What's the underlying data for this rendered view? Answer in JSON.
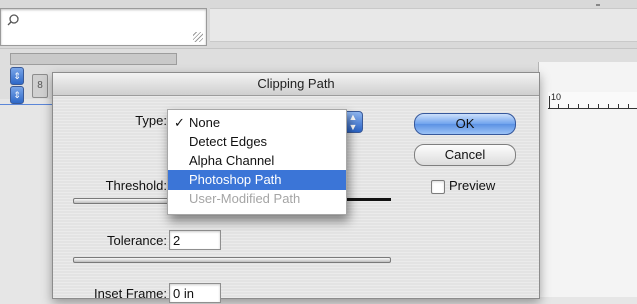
{
  "dialog": {
    "title": "Clipping Path",
    "type_label": "Type:",
    "threshold_label": "Threshold:",
    "tolerance_label": "Tolerance:",
    "tolerance_value": "2",
    "inset_label": "Inset Frame:",
    "inset_value": "0 in",
    "ok_label": "OK",
    "cancel_label": "Cancel",
    "preview_label": "Preview",
    "preview_checked": false
  },
  "type_menu": {
    "items": [
      {
        "label": "None",
        "checked": true,
        "state": "normal"
      },
      {
        "label": "Detect Edges",
        "checked": false,
        "state": "normal"
      },
      {
        "label": "Alpha Channel",
        "checked": false,
        "state": "normal"
      },
      {
        "label": "Photoshop Path",
        "checked": false,
        "state": "highlighted"
      },
      {
        "label": "User-Modified Path",
        "checked": false,
        "state": "disabled"
      }
    ],
    "check_glyph": "✓"
  },
  "ruler": {
    "label": "10"
  },
  "colors": {
    "accent": "#3b75d7",
    "default_button": "#5b91e4"
  }
}
